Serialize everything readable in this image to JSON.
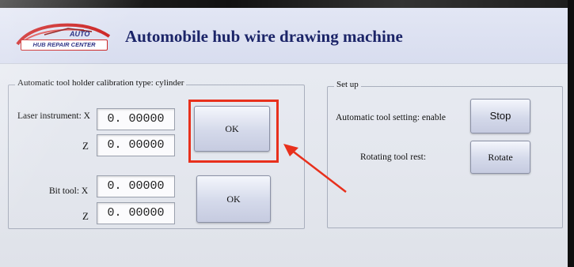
{
  "header": {
    "title": "Automobile hub wire drawing machine",
    "logo_auto": "AUTO",
    "logo_center": "HUB REPAIR CENTER"
  },
  "left_panel": {
    "legend": "Automatic tool holder calibration type: cylinder",
    "laser_label": "Laser instrument: X",
    "laser_z_label": "Z",
    "laser_x_value": "0. 00000",
    "laser_z_value": "0. 00000",
    "laser_ok": "OK",
    "bit_label": "Bit tool: X",
    "bit_z_label": "Z",
    "bit_x_value": "0. 00000",
    "bit_z_value": "0. 00000",
    "bit_ok": "OK"
  },
  "right_panel": {
    "legend": "Set up",
    "auto_tool_label": "Automatic tool setting: enable",
    "stop_button": "Stop",
    "rotating_label": "Rotating tool rest:",
    "rotate_button": "Rotate"
  },
  "colors": {
    "annotation": "#e8301c",
    "title": "#1b2468"
  },
  "icons": {
    "logo": "car-logo-icon",
    "annotation": "arrow-annotation-icon"
  }
}
